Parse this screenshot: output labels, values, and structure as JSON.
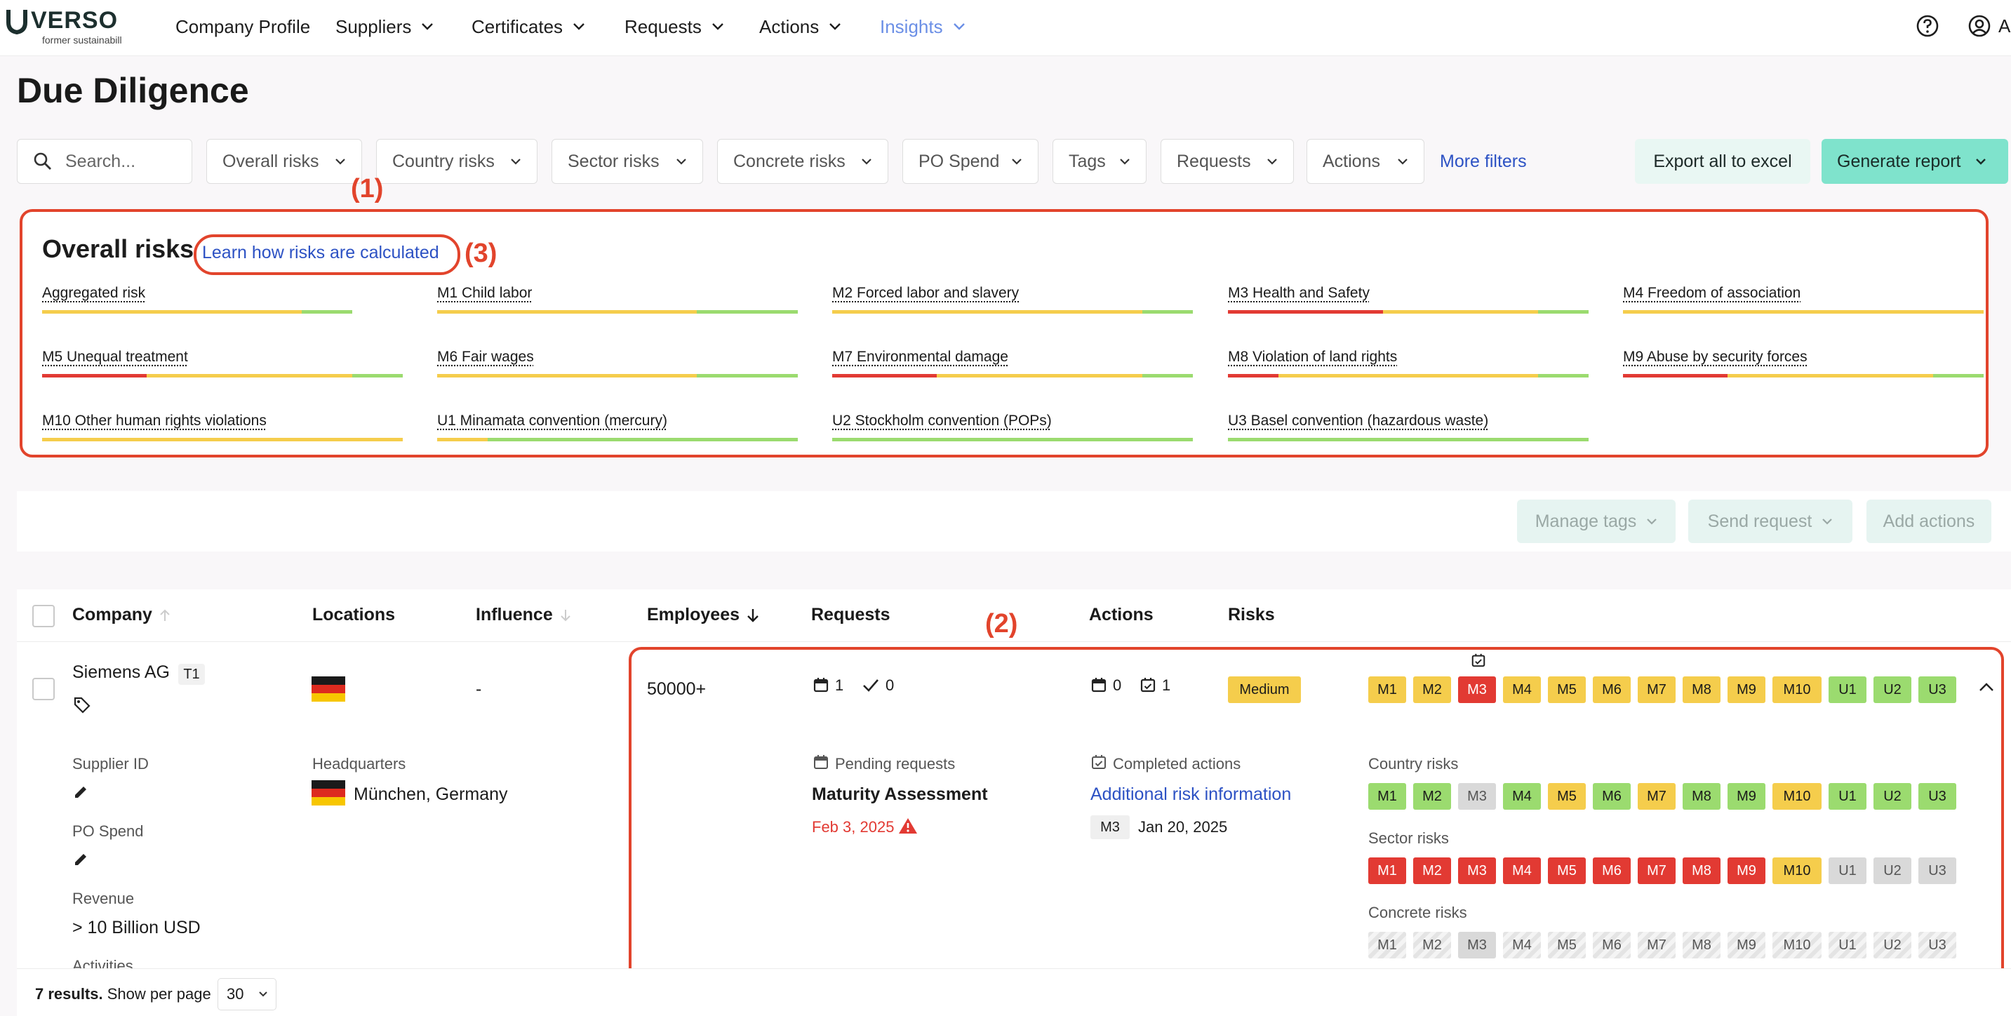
{
  "brand": {
    "name": "VERSO",
    "tagline": "former sustainabill"
  },
  "nav": {
    "company_profile": "Company Profile",
    "suppliers": "Suppliers",
    "certificates": "Certificates",
    "requests": "Requests",
    "actions": "Actions",
    "insights": "Insights",
    "user_initial": "A"
  },
  "page": {
    "title": "Due Diligence"
  },
  "filters": {
    "search_placeholder": "Search...",
    "overall_risks": "Overall risks",
    "country_risks": "Country risks",
    "sector_risks": "Sector risks",
    "concrete_risks": "Concrete risks",
    "po_spend": "PO Spend",
    "tags": "Tags",
    "requests": "Requests",
    "actions": "Actions",
    "more_filters": "More filters",
    "export": "Export all to excel",
    "generate": "Generate report"
  },
  "annotations": {
    "a1": "(1)",
    "a2": "(2)",
    "a3": "(3)"
  },
  "overall_risks": {
    "title": "Overall risks",
    "learn_link": "Learn how risks are calculated",
    "items": [
      {
        "label": "Aggregated risk",
        "bar": [
          0,
          72,
          86
        ]
      },
      {
        "label": "M1 Child labor",
        "bar": [
          0,
          72,
          100
        ]
      },
      {
        "label": "M2 Forced labor and slavery",
        "bar": [
          0,
          86,
          100
        ]
      },
      {
        "label": "M3 Health and Safety",
        "bar": [
          43,
          86,
          100
        ]
      },
      {
        "label": "M4 Freedom of association",
        "bar": [
          0,
          100,
          100
        ]
      },
      {
        "label": "M5 Unequal treatment",
        "bar": [
          29,
          86,
          100
        ]
      },
      {
        "label": "M6 Fair wages",
        "bar": [
          0,
          72,
          100
        ]
      },
      {
        "label": "M7 Environmental damage",
        "bar": [
          29,
          86,
          100
        ]
      },
      {
        "label": "M8 Violation of land rights",
        "bar": [
          14,
          86,
          100
        ]
      },
      {
        "label": "M9 Abuse by security forces",
        "bar": [
          29,
          86,
          100
        ]
      },
      {
        "label": "M10 Other human rights violations",
        "bar": [
          0,
          100,
          100
        ]
      },
      {
        "label": "U1 Minamata convention (mercury)",
        "bar": [
          0,
          14,
          100
        ]
      },
      {
        "label": "U2 Stockholm convention (POPs)",
        "bar": [
          0,
          0,
          100
        ]
      },
      {
        "label": "U3 Basel convention (hazardous waste)",
        "bar": [
          0,
          0,
          100
        ]
      }
    ]
  },
  "bulk_actions": {
    "manage_tags": "Manage tags",
    "send_request": "Send request",
    "add_actions": "Add actions"
  },
  "table": {
    "headers": {
      "company": "Company",
      "locations": "Locations",
      "influence": "Influence",
      "employees": "Employees",
      "requests": "Requests",
      "actions": "Actions",
      "risks": "Risks"
    },
    "row": {
      "company": "Siemens AG",
      "tier": "T1",
      "influence": "-",
      "employees": "50000+",
      "requests_pending": "1",
      "requests_done": "0",
      "actions_open": "0",
      "actions_done": "1",
      "overall_level": "Medium",
      "risk_labels": [
        "M1",
        "M2",
        "M3",
        "M4",
        "M5",
        "M6",
        "M7",
        "M8",
        "M9",
        "M10",
        "U1",
        "U2",
        "U3"
      ],
      "overall_colors": [
        "y",
        "y",
        "r",
        "y",
        "y",
        "y",
        "y",
        "y",
        "y",
        "y",
        "g",
        "g",
        "g"
      ],
      "country_colors": [
        "g",
        "g",
        "n",
        "g",
        "y",
        "g",
        "y",
        "g",
        "g",
        "y",
        "g",
        "g",
        "g"
      ],
      "sector_colors": [
        "r",
        "r",
        "r",
        "r",
        "r",
        "r",
        "r",
        "r",
        "r",
        "y",
        "n",
        "n",
        "n"
      ],
      "concrete_colors": [
        "h",
        "h",
        "n",
        "h",
        "h",
        "h",
        "h",
        "h",
        "h",
        "h",
        "h",
        "h",
        "h"
      ],
      "supplier_id_label": "Supplier ID",
      "po_spend_label": "PO Spend",
      "revenue_label": "Revenue",
      "revenue_value": "> 10 Billion USD",
      "activities_label": "Activities",
      "hq_label": "Headquarters",
      "hq_value": "München, Germany",
      "pending_requests_label": "Pending requests",
      "pending_request_name": "Maturity Assessment",
      "pending_request_date": "Feb 3, 2025",
      "completed_actions_label": "Completed actions",
      "completed_action_name": "Additional risk information",
      "completed_action_tag": "M3",
      "completed_action_date": "Jan 20, 2025",
      "country_risks_label": "Country risks",
      "sector_risks_label": "Sector risks",
      "concrete_risks_label": "Concrete risks"
    }
  },
  "footer": {
    "results": "7 results.",
    "per_page_label": "Show per page",
    "per_page_value": "30"
  },
  "colors": {
    "red": "#e23a33",
    "yellow": "#f5cd4c",
    "green": "#9bdb6f",
    "accent_teal": "#7fe3cc",
    "link_blue": "#2d52c4",
    "annotation_red": "#e2442c"
  }
}
